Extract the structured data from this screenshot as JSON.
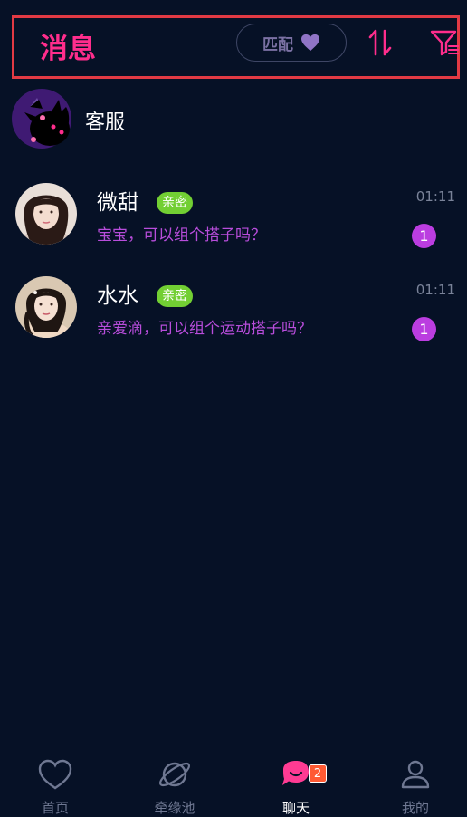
{
  "header": {
    "title": "消息",
    "match_label": "匹配",
    "heart_icon": "heart-icon",
    "sort_icon": "sort-icon",
    "filter_icon": "filter-icon"
  },
  "customer_service": {
    "name": "客服",
    "avatar_icon": "cat-avatar"
  },
  "chats": [
    {
      "name": "微甜",
      "badge": "亲密",
      "message": "宝宝，可以组个搭子吗？",
      "time": "01:11",
      "unread": "1"
    },
    {
      "name": "水水",
      "badge": "亲密",
      "message": "亲爱滴，可以组个运动搭子吗？",
      "time": "01:11",
      "unread": "1"
    }
  ],
  "tabbar": {
    "tabs": [
      {
        "label": "首页",
        "icon": "heart-outline-icon"
      },
      {
        "label": "牵缘池",
        "icon": "planet-icon"
      },
      {
        "label": "聊天",
        "icon": "chat-bubble-icon",
        "active": true,
        "badge": "2"
      },
      {
        "label": "我的",
        "icon": "person-icon"
      }
    ]
  },
  "colors": {
    "background": "#061126",
    "accent_pink": "#ff2d8c",
    "message_purple": "#b84ddb",
    "badge_green": "#72cf33",
    "unread_purple": "#bb3de0",
    "header_outline": "#e23a44"
  }
}
